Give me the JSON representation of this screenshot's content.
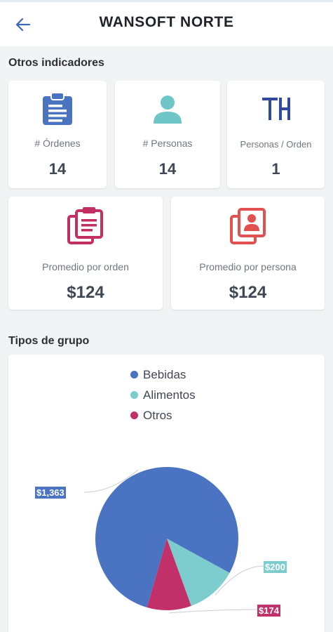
{
  "header": {
    "title": "WANSOFT NORTE",
    "back_icon": "arrow-left-icon"
  },
  "indicators": {
    "section_title": "Otros indicadores",
    "cards": [
      {
        "icon": "clipboard-icon",
        "label": "# Órdenes",
        "value": "14",
        "color": "#4a73c1"
      },
      {
        "icon": "person-icon",
        "label": "# Personas",
        "value": "14",
        "color": "#6fc6c8"
      },
      {
        "icon": "table-icon",
        "label": "Personas / Orden",
        "value": "1",
        "color": "#2f4aa0"
      },
      {
        "icon": "copy-clipboard-icon",
        "label": "Promedio por orden",
        "value": "$124",
        "color": "#c42f62"
      },
      {
        "icon": "contact-book-icon",
        "label": "Promedio por persona",
        "value": "$124",
        "color": "#e0514f"
      }
    ]
  },
  "groups": {
    "section_title": "Tipos de grupo"
  },
  "chart_data": {
    "type": "pie",
    "legend_position": "top",
    "categories": [
      "Bebidas",
      "Alimentos",
      "Otros"
    ],
    "values": [
      1363,
      200,
      174
    ],
    "value_labels": [
      "$1,363",
      "$200",
      "$174"
    ],
    "colors": [
      "#4a73c1",
      "#7ecdce",
      "#c2306a"
    ]
  }
}
